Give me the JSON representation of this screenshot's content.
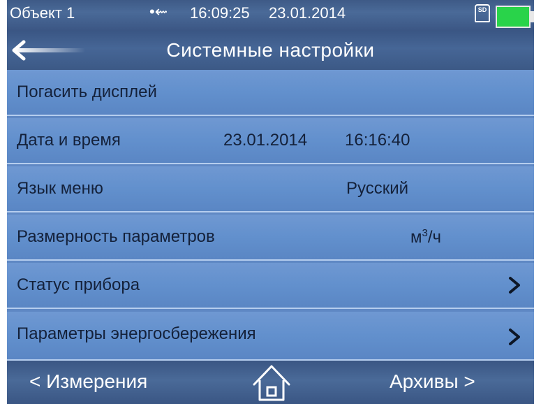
{
  "status": {
    "object_label": "Объект 1",
    "usb_icon": "usb-icon",
    "time": "16:09:25",
    "date": "23.01.2014",
    "sd_label": "SD",
    "battery_color": "#29d34a"
  },
  "header": {
    "title": "Системные настройки",
    "back_icon": "back-arrow-icon"
  },
  "settings": {
    "display_off_label": "Погасить дисплей",
    "datetime_label": "Дата и время",
    "datetime_date": "23.01.2014",
    "datetime_time": "16:16:40",
    "language_label": "Язык меню",
    "language_value": "Русский",
    "units_label": "Размерность параметров",
    "units_value_base": "м",
    "units_value_exp": "3",
    "units_value_tail": "/ч",
    "device_status_label": "Статус прибора",
    "energy_saving_label": "Параметры энергосбережения"
  },
  "nav": {
    "left_label": "< Измерения",
    "right_label": "Архивы >",
    "home_icon": "home-icon"
  },
  "colors": {
    "row_blue": "#6290cd",
    "bar_dark": "#3a5684",
    "text_dark": "#14213a"
  }
}
